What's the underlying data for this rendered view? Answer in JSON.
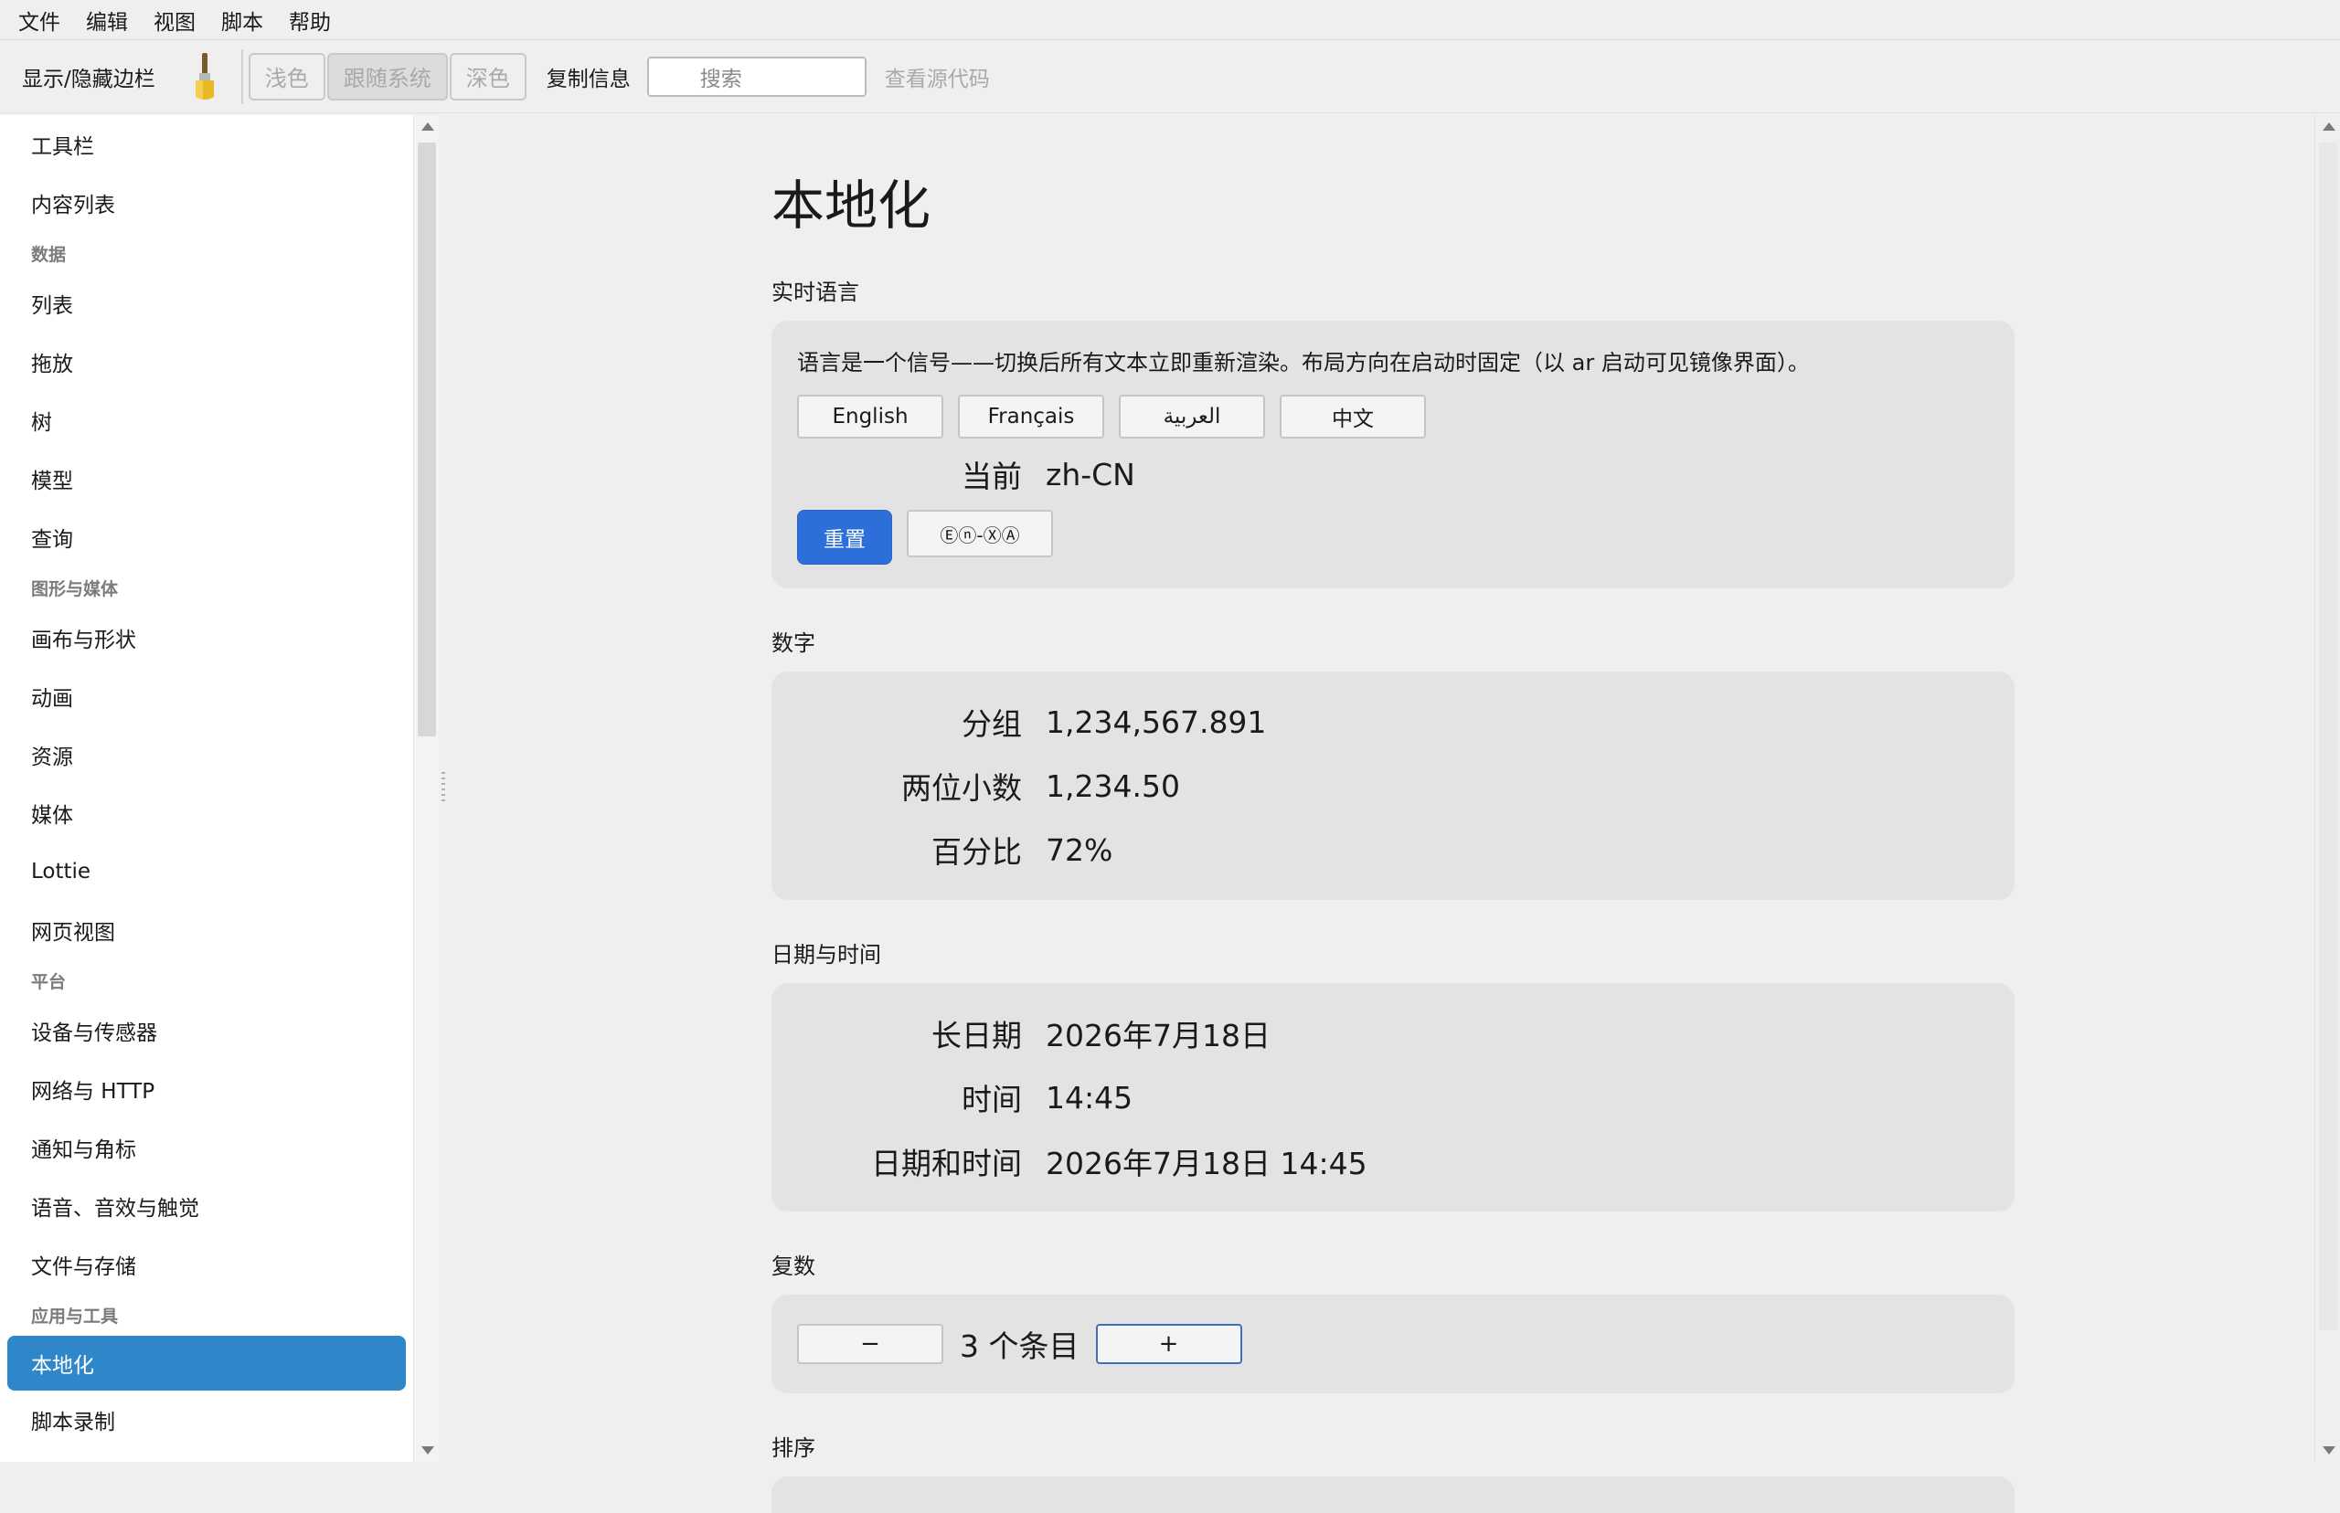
{
  "menu": [
    "文件",
    "编辑",
    "视图",
    "脚本",
    "帮助"
  ],
  "toolbar": {
    "toggle_sidebar": "显示/隐藏边栏",
    "theme_light": "浅色",
    "theme_system": "跟随系统",
    "theme_dark": "深色",
    "copy_info": "复制信息",
    "search_placeholder": "搜索",
    "view_source": "查看源代码"
  },
  "sidebar": {
    "items": [
      {
        "type": "item",
        "label": "工具栏"
      },
      {
        "type": "item",
        "label": "内容列表"
      },
      {
        "type": "header",
        "label": "数据"
      },
      {
        "type": "item",
        "label": "列表"
      },
      {
        "type": "item",
        "label": "拖放"
      },
      {
        "type": "item",
        "label": "树"
      },
      {
        "type": "item",
        "label": "模型"
      },
      {
        "type": "item",
        "label": "查询"
      },
      {
        "type": "header",
        "label": "图形与媒体"
      },
      {
        "type": "item",
        "label": "画布与形状"
      },
      {
        "type": "item",
        "label": "动画"
      },
      {
        "type": "item",
        "label": "资源"
      },
      {
        "type": "item",
        "label": "媒体"
      },
      {
        "type": "item",
        "label": "Lottie"
      },
      {
        "type": "item",
        "label": "网页视图"
      },
      {
        "type": "header",
        "label": "平台"
      },
      {
        "type": "item",
        "label": "设备与传感器"
      },
      {
        "type": "item",
        "label": "网络与 HTTP"
      },
      {
        "type": "item",
        "label": "通知与角标"
      },
      {
        "type": "item",
        "label": "语音、音效与触觉"
      },
      {
        "type": "item",
        "label": "文件与存储"
      },
      {
        "type": "header",
        "label": "应用与工具"
      },
      {
        "type": "item",
        "label": "本地化",
        "active": true
      },
      {
        "type": "item",
        "label": "脚本录制"
      }
    ]
  },
  "main": {
    "title": "本地化",
    "live_language": {
      "title": "实时语言",
      "description": "语言是一个信号——切换后所有文本立即重新渲染。布局方向在启动时固定（以 ar 启动可见镜像界面）。",
      "languages": [
        "English",
        "Français",
        "العربية",
        "中文"
      ],
      "current_label": "当前",
      "current_value": "zh-CN",
      "reset_label": "重置",
      "pseudo_label": "Ⓔⓝ-ⓍⒶ"
    },
    "numbers": {
      "title": "数字",
      "rows": [
        {
          "label": "分组",
          "value": "1,234,567.891"
        },
        {
          "label": "两位小数",
          "value": "1,234.50"
        },
        {
          "label": "百分比",
          "value": "72%"
        }
      ]
    },
    "datetime": {
      "title": "日期与时间",
      "rows": [
        {
          "label": "长日期",
          "value": "2026年7月18日"
        },
        {
          "label": "时间",
          "value": "14:45"
        },
        {
          "label": "日期和时间",
          "value": "2026年7月18日 14:45"
        }
      ]
    },
    "plural": {
      "title": "复数",
      "minus": "−",
      "plus": "+",
      "text": "3 个条目"
    },
    "sort": {
      "title": "排序"
    }
  }
}
